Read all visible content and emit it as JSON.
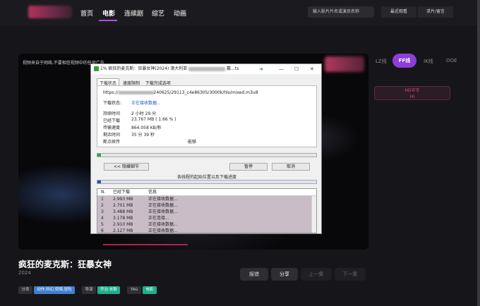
{
  "nav": {
    "items": [
      "首页",
      "电影",
      "连续剧",
      "综艺",
      "动画"
    ],
    "active": "电影"
  },
  "search": {
    "placeholder": "输入影片片名或演员名称"
  },
  "header_buttons": [
    "最近观看",
    "求片/留言"
  ],
  "player": {
    "notice": "视频来自于网络,不要相信视频中的任何广告"
  },
  "lines": {
    "items": [
      "LZ线",
      "FF线",
      "IK线",
      "OOE"
    ],
    "active": "FF线",
    "hd_label": "HD中字",
    "hd_sub": "HI"
  },
  "dialog": {
    "title": "1% 疯狂的麦克斯：狂暴女神(2024) 澳大利亚",
    "title_suffix": "戴...ts",
    "tabs": [
      "下载状态",
      "速度限制",
      "下载完成选项"
    ],
    "url_prefix": "https://",
    "url_suffix": "240625/29113_c4e86305/3000k/hls/mixed.m3u8",
    "status_label": "下载状态:",
    "status_value": "正在接收数据...",
    "rows": [
      {
        "label": "持续时间",
        "value": "2 小时 29 分"
      },
      {
        "label": "已经下载",
        "value": "23.767  MB  ( 1.66 % )"
      },
      {
        "label": "传输速度",
        "value": "864.058  KB/秒"
      },
      {
        "label": "剩余时间",
        "value": "35 分 39 秒"
      },
      {
        "label": "断点续传",
        "value": "能够"
      }
    ],
    "progress": 0.0166,
    "btn_hide": "<< 隐藏细节",
    "btn_pause": "暂停",
    "btn_cancel": "取消",
    "segments_label": "各线程的起始位置以及下载进度",
    "table_headers": [
      "N.",
      "已经下载",
      "信息"
    ],
    "table_rows": [
      [
        "1",
        "2.993  MB",
        "正在接收数据..."
      ],
      [
        "2",
        "2.701  MB",
        "正在接收数据..."
      ],
      [
        "3",
        "3.488  MB",
        "正在接收数据..."
      ],
      [
        "4",
        "3.178  MB",
        "正在连接..."
      ],
      [
        "5",
        "2.910  MB",
        "正在接收数据..."
      ],
      [
        "6",
        "2.127  MB",
        "正在接收数据..."
      ]
    ]
  },
  "movie": {
    "title": "疯狂的麦克斯：狂暴女神",
    "year": "2024",
    "buttons": [
      "报错",
      "分享",
      "上一集",
      "下一集"
    ],
    "tags": [
      {
        "label": "分类",
        "value": "动作,科幻,惊悚,冒险"
      },
      {
        "label": "导演",
        "value": "乔治·米勒"
      },
      {
        "label": "TAG",
        "value": "电影"
      }
    ]
  }
}
